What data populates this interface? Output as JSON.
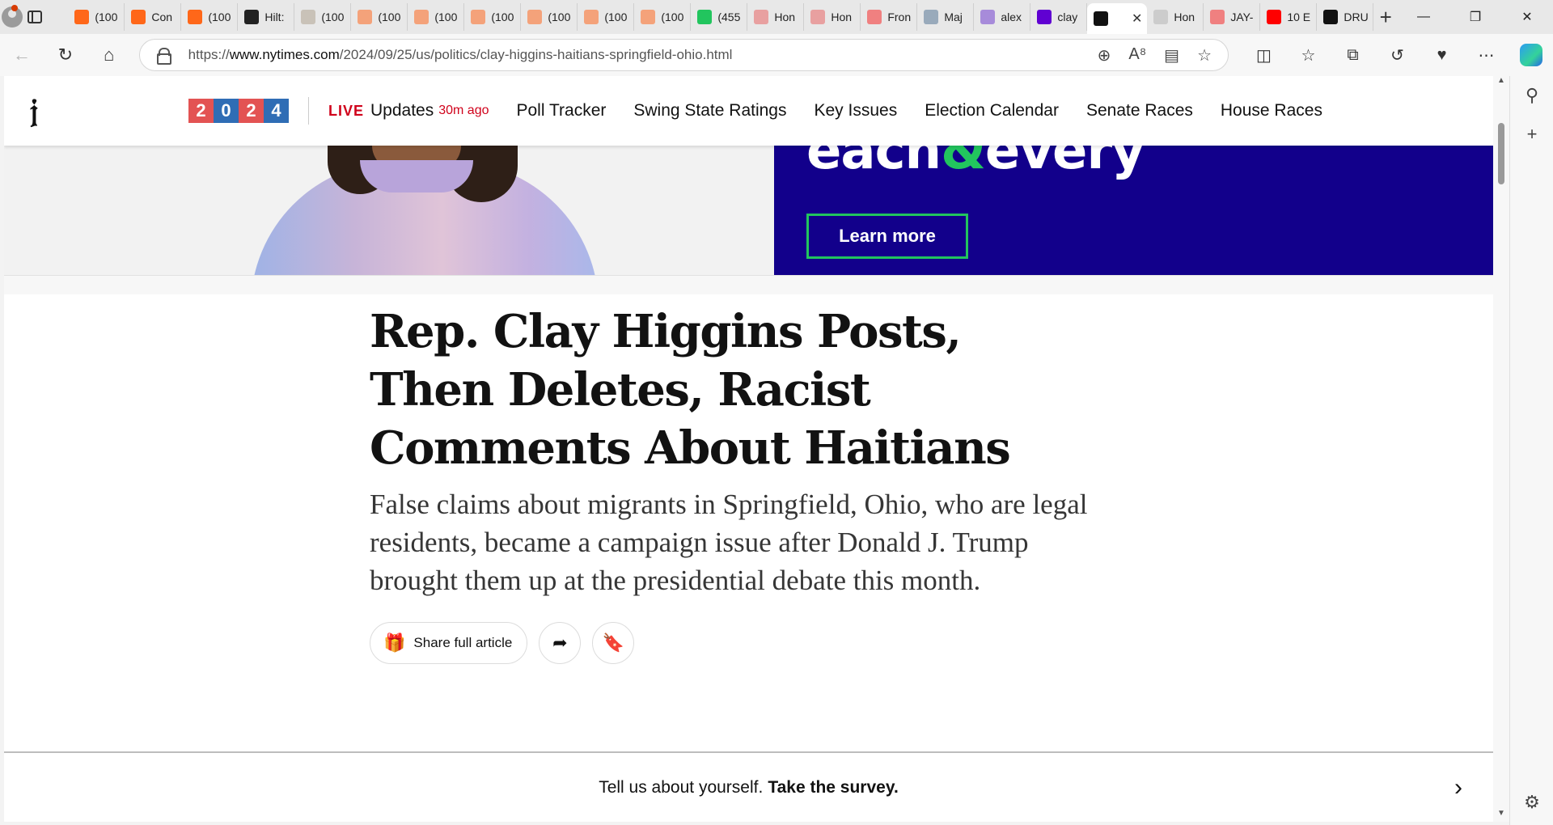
{
  "browser": {
    "tabs": [
      {
        "label": "(100",
        "icon": "substack-icon",
        "color": "#ff6719"
      },
      {
        "label": "Con",
        "icon": "substack-icon",
        "color": "#ff6719"
      },
      {
        "label": "(100",
        "icon": "substack-icon",
        "color": "#ff6719"
      },
      {
        "label": "Hilt:",
        "icon": "letter-l-icon",
        "color": "#222222"
      },
      {
        "label": "(100",
        "icon": "person-icon",
        "color": "#c9c2b8"
      },
      {
        "label": "(100",
        "icon": "substack-icon",
        "color": "#f4a27a"
      },
      {
        "label": "(100",
        "icon": "substack-icon",
        "color": "#f4a27a"
      },
      {
        "label": "(100",
        "icon": "substack-icon",
        "color": "#f4a27a"
      },
      {
        "label": "(100",
        "icon": "substack-icon",
        "color": "#f4a27a"
      },
      {
        "label": "(100",
        "icon": "substack-icon",
        "color": "#f4a27a"
      },
      {
        "label": "(100",
        "icon": "substack-icon",
        "color": "#f4a27a"
      },
      {
        "label": "(455",
        "icon": "letter-g-icon",
        "color": "#22c55e"
      },
      {
        "label": "Hon",
        "icon": "mascot-icon",
        "color": "#e8a0a0"
      },
      {
        "label": "Hon",
        "icon": "mascot-icon",
        "color": "#e8a0a0"
      },
      {
        "label": "Fron",
        "icon": "youtube-icon",
        "color": "#f08080"
      },
      {
        "label": "Maj",
        "icon": "search-icon",
        "color": "#9ab"
      },
      {
        "label": "alex",
        "icon": "yahoo-icon",
        "color": "#a78bda"
      },
      {
        "label": "clay",
        "icon": "yahoo-icon",
        "color": "#6001d2"
      },
      {
        "label": "",
        "icon": "nyt-icon",
        "color": "#111111",
        "active": true
      },
      {
        "label": "Hon",
        "icon": "bird-icon",
        "color": "#ccc"
      },
      {
        "label": "JAY-",
        "icon": "youtube-icon",
        "color": "#f08080"
      },
      {
        "label": "10 E",
        "icon": "youtube-icon",
        "color": "#ff0000"
      },
      {
        "label": "DRU",
        "icon": "dr-icon",
        "color": "#111111"
      }
    ],
    "url_prefix": "https://",
    "url_host": "www.nytimes.com",
    "url_path": "/2024/09/25/us/politics/clay-higgins-haitians-springfield-ohio.html"
  },
  "nyt": {
    "year_digits": [
      "2",
      "0",
      "2",
      "4"
    ],
    "year_colors": [
      "#e35353",
      "#2f6db5",
      "#e35353",
      "#2f6db5"
    ],
    "live_label": "LIVE",
    "updates_label": "Updates",
    "updates_ago": "30m ago",
    "nav": [
      "Poll Tracker",
      "Swing State Ratings",
      "Key Issues",
      "Election Calendar",
      "Senate Races",
      "House Races"
    ]
  },
  "ad": {
    "brand_left": "each",
    "brand_amp": "&",
    "brand_right": "every",
    "button": "Learn more"
  },
  "article": {
    "headline": "Rep. Clay Higgins Posts, Then Deletes, Racist Comments About Haitians",
    "summary": "False claims about migrants in Springfield, Ohio, who are legal residents, became a campaign issue after Donald J. Trump brought them up at the presidential debate this month.",
    "share_label": "Share full article"
  },
  "survey": {
    "prefix": "Tell us about yourself.",
    "cta": "Take the survey."
  }
}
